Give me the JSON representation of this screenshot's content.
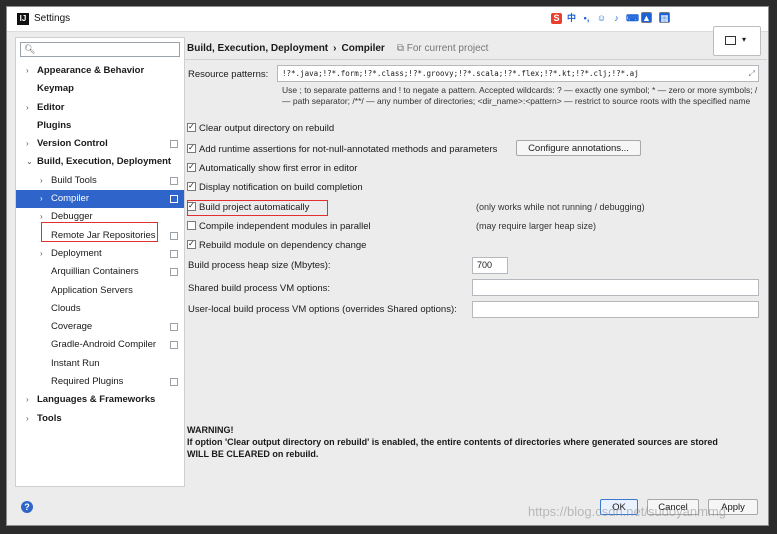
{
  "window": {
    "title": "Settings",
    "app_icon": "IJ"
  },
  "ime_toolbar": {
    "logo": "S",
    "lang": "中",
    "punct": "•,",
    "emoji": "☺",
    "mic": "♪",
    "keyboard": "⌨",
    "icons": [
      "shirt-icon",
      "apps-icon"
    ]
  },
  "sidebar": {
    "search_placeholder": "",
    "items": [
      {
        "label": "Appearance & Behavior",
        "indent": 0,
        "arrow": "›",
        "bold": true,
        "copy": false,
        "selected": false
      },
      {
        "label": "Keymap",
        "indent": 0,
        "arrow": "",
        "bold": true,
        "copy": false,
        "selected": false
      },
      {
        "label": "Editor",
        "indent": 0,
        "arrow": "›",
        "bold": true,
        "copy": false,
        "selected": false
      },
      {
        "label": "Plugins",
        "indent": 0,
        "arrow": "",
        "bold": true,
        "copy": false,
        "selected": false
      },
      {
        "label": "Version Control",
        "indent": 0,
        "arrow": "›",
        "bold": true,
        "copy": true,
        "selected": false
      },
      {
        "label": "Build, Execution, Deployment",
        "indent": 0,
        "arrow": "⌄",
        "bold": true,
        "copy": false,
        "selected": false
      },
      {
        "label": "Build Tools",
        "indent": 1,
        "arrow": "›",
        "bold": false,
        "copy": true,
        "selected": false
      },
      {
        "label": "Compiler",
        "indent": 1,
        "arrow": "›",
        "bold": false,
        "copy": true,
        "selected": true
      },
      {
        "label": "Debugger",
        "indent": 1,
        "arrow": "›",
        "bold": false,
        "copy": false,
        "selected": false
      },
      {
        "label": "Remote Jar Repositories",
        "indent": 1,
        "arrow": "",
        "bold": false,
        "copy": true,
        "selected": false
      },
      {
        "label": "Deployment",
        "indent": 1,
        "arrow": "›",
        "bold": false,
        "copy": true,
        "selected": false
      },
      {
        "label": "Arquillian Containers",
        "indent": 1,
        "arrow": "",
        "bold": false,
        "copy": true,
        "selected": false
      },
      {
        "label": "Application Servers",
        "indent": 1,
        "arrow": "",
        "bold": false,
        "copy": false,
        "selected": false
      },
      {
        "label": "Clouds",
        "indent": 1,
        "arrow": "",
        "bold": false,
        "copy": false,
        "selected": false
      },
      {
        "label": "Coverage",
        "indent": 1,
        "arrow": "",
        "bold": false,
        "copy": true,
        "selected": false
      },
      {
        "label": "Gradle-Android Compiler",
        "indent": 1,
        "arrow": "",
        "bold": false,
        "copy": true,
        "selected": false
      },
      {
        "label": "Instant Run",
        "indent": 1,
        "arrow": "",
        "bold": false,
        "copy": false,
        "selected": false
      },
      {
        "label": "Required Plugins",
        "indent": 1,
        "arrow": "",
        "bold": false,
        "copy": true,
        "selected": false
      },
      {
        "label": "Languages & Frameworks",
        "indent": 0,
        "arrow": "›",
        "bold": true,
        "copy": false,
        "selected": false
      },
      {
        "label": "Tools",
        "indent": 0,
        "arrow": "›",
        "bold": true,
        "copy": false,
        "selected": false
      }
    ]
  },
  "breadcrumb": {
    "parent": "Build, Execution, Deployment",
    "separator": "›",
    "current": "Compiler",
    "scope": "For current project"
  },
  "resource_patterns": {
    "label": "Resource patterns:",
    "value": "!?*.java;!?*.form;!?*.class;!?*.groovy;!?*.scala;!?*.flex;!?*.kt;!?*.clj;!?*.aj",
    "hint": "Use ; to separate patterns and ! to negate a pattern. Accepted wildcards: ? — exactly one symbol; * — zero or more symbols; / — path separator; /**/ — any number of directories; <dir_name>:<pattern> — restrict to source roots with the specified name"
  },
  "options": [
    {
      "label": "Clear output directory on rebuild",
      "checked": true,
      "note": ""
    },
    {
      "label": "Add runtime assertions for not-null-annotated methods and parameters",
      "checked": true,
      "note": ""
    },
    {
      "label": "Automatically show first error in editor",
      "checked": true,
      "note": ""
    },
    {
      "label": "Display notification on build completion",
      "checked": true,
      "note": ""
    },
    {
      "label": "Build project automatically",
      "checked": true,
      "note": "(only works while not running / debugging)"
    },
    {
      "label": "Compile independent modules in parallel",
      "checked": false,
      "note": "(may require larger heap size)"
    },
    {
      "label": "Rebuild module on dependency change",
      "checked": true,
      "note": ""
    }
  ],
  "configure_annotations_label": "Configure annotations...",
  "heap": {
    "label": "Build process heap size (Mbytes):",
    "value": "700"
  },
  "shared_vm": {
    "label": "Shared build process VM options:",
    "value": ""
  },
  "user_vm": {
    "label": "User-local build process VM options (overrides Shared options):",
    "value": ""
  },
  "warning": {
    "title": "WARNING!",
    "line1": "If option 'Clear output directory on rebuild' is enabled, the entire contents of directories where generated sources are stored",
    "line2": "WILL BE CLEARED on rebuild."
  },
  "buttons": {
    "ok": "OK",
    "cancel": "Cancel",
    "apply": "Apply"
  },
  "help_label": "?",
  "watermark": "https://blog.csdn.net/sudoyanmmg"
}
